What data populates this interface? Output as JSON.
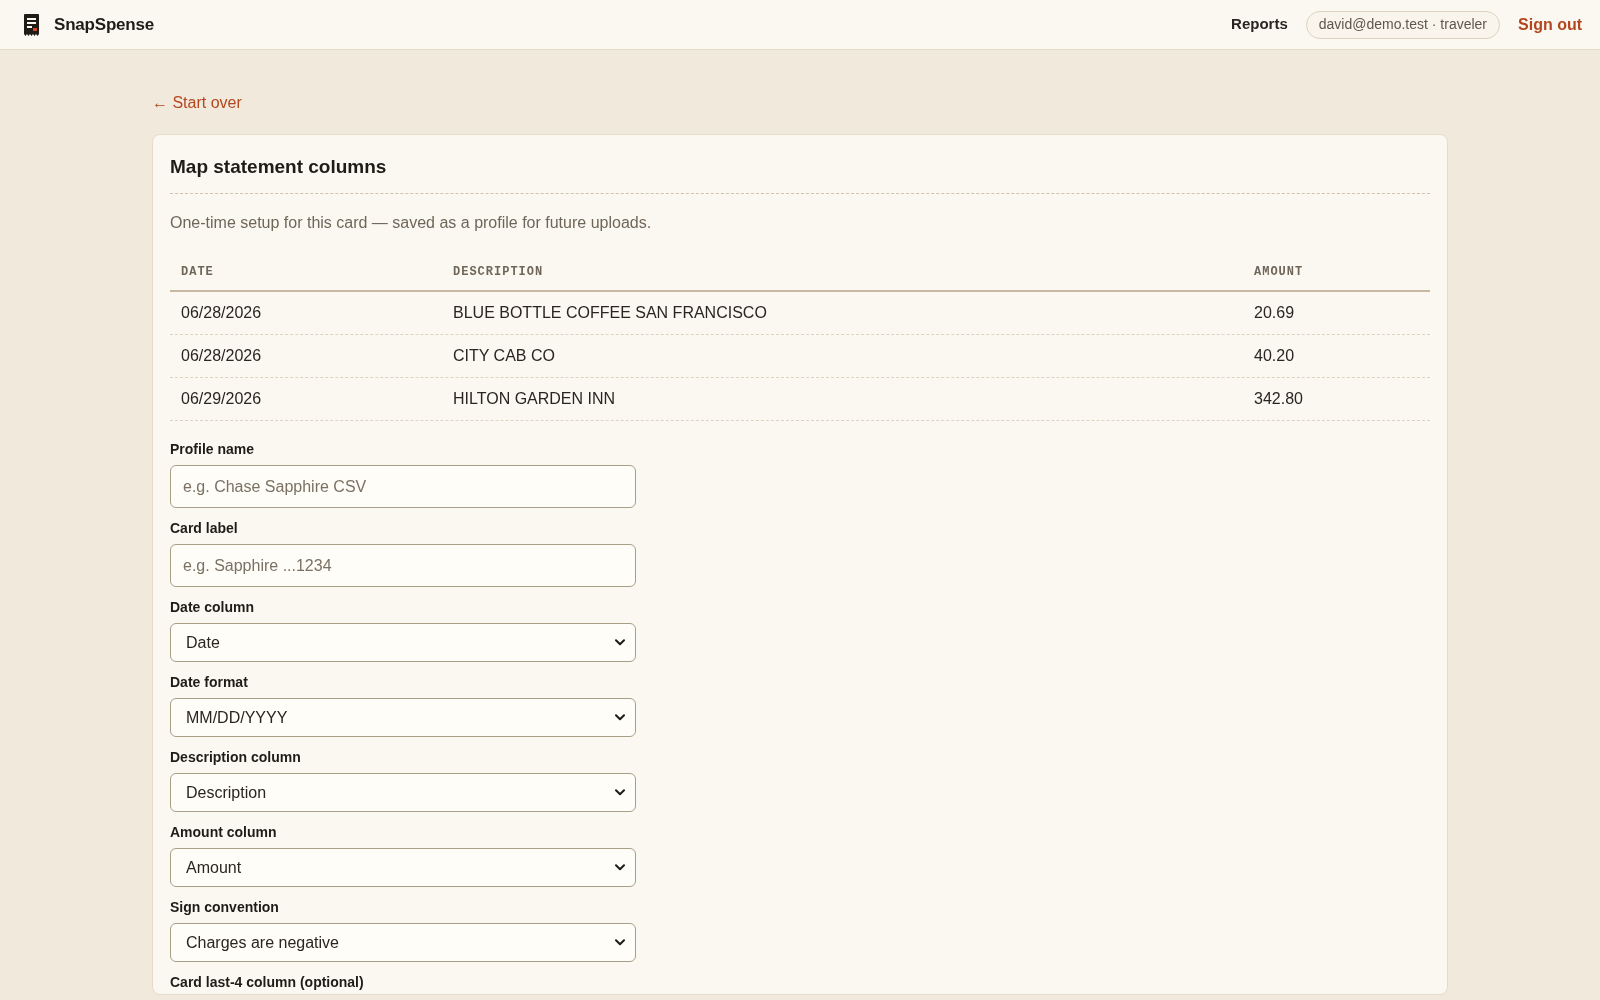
{
  "header": {
    "brand": "SnapSpense",
    "nav": [
      {
        "label": "Reports"
      }
    ],
    "user_badge": "david@demo.test · traveler",
    "sign_out": "Sign out"
  },
  "back_link": "← Start over",
  "card": {
    "title": "Map statement columns",
    "subtitle": "One-time setup for this card — saved as a profile for future uploads.",
    "preview_table": {
      "columns": [
        "DATE",
        "DESCRIPTION",
        "AMOUNT"
      ],
      "rows": [
        [
          "06/28/2026",
          "BLUE BOTTLE COFFEE SAN FRANCISCO",
          "20.69"
        ],
        [
          "06/28/2026",
          "CITY CAB CO",
          "40.20"
        ],
        [
          "06/29/2026",
          "HILTON GARDEN INN",
          "342.80"
        ]
      ]
    },
    "fields": [
      {
        "kind": "text",
        "label": "Profile name",
        "placeholder": "e.g. Chase Sapphire CSV"
      },
      {
        "kind": "text",
        "label": "Card label",
        "placeholder": "e.g. Sapphire ...1234"
      },
      {
        "kind": "select",
        "label": "Date column",
        "value": "Date"
      },
      {
        "kind": "select",
        "label": "Date format",
        "value": "MM/DD/YYYY"
      },
      {
        "kind": "select",
        "label": "Description column",
        "value": "Description"
      },
      {
        "kind": "select",
        "label": "Amount column",
        "value": "Amount"
      },
      {
        "kind": "select",
        "label": "Sign convention",
        "value": "Charges are negative"
      },
      {
        "kind": "select",
        "label": "Card last-4 column (optional)"
      }
    ]
  }
}
